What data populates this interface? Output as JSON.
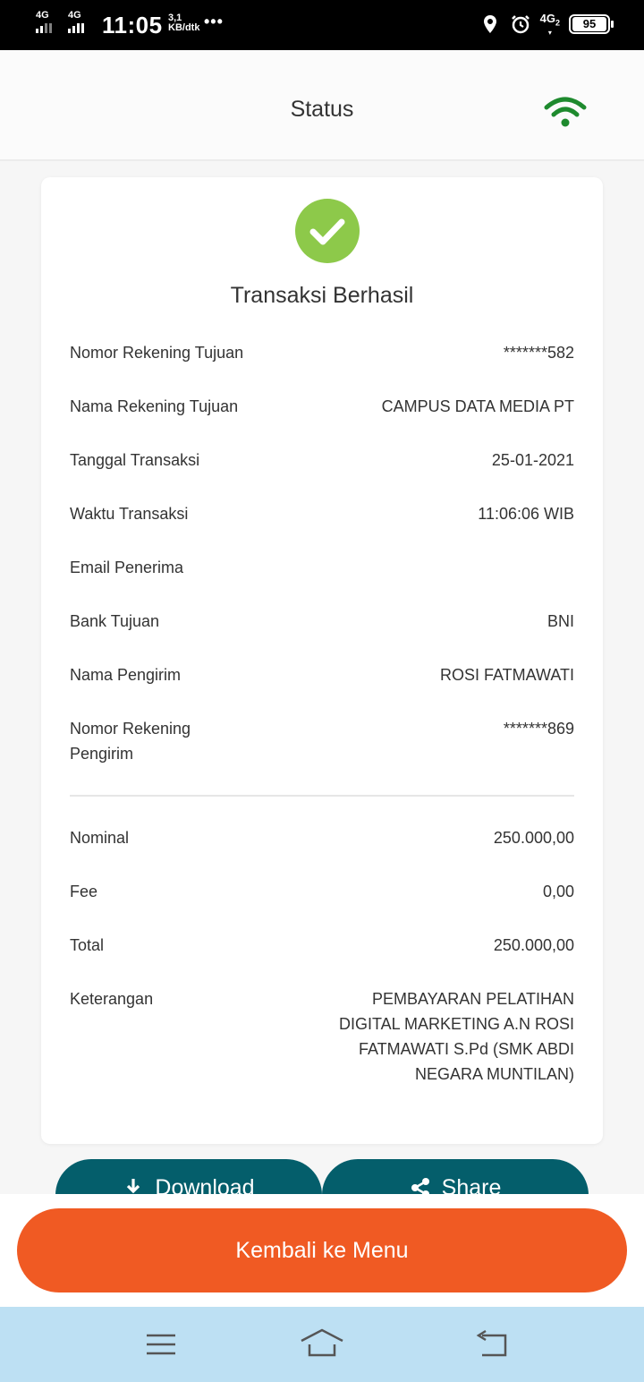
{
  "status_bar": {
    "sim1": "4G",
    "sim2": "4G",
    "time": "11:05",
    "speed_value": "3,1",
    "speed_unit": "KB/dtk",
    "more": "•••",
    "network": "4G",
    "network_sub": "2",
    "battery": "95"
  },
  "header": {
    "title": "Status"
  },
  "receipt": {
    "status_title": "Transaksi Berhasil",
    "rows": [
      {
        "label": "Nomor Rekening Tujuan",
        "value": "*******582"
      },
      {
        "label": "Nama Rekening Tujuan",
        "value": "CAMPUS DATA MEDIA PT"
      },
      {
        "label": "Tanggal Transaksi",
        "value": "25-01-2021"
      },
      {
        "label": "Waktu Transaksi",
        "value": "11:06:06 WIB"
      },
      {
        "label": "Email Penerima",
        "value": ""
      },
      {
        "label": "Bank Tujuan",
        "value": "BNI"
      },
      {
        "label": "Nama Pengirim",
        "value": "ROSI FATMAWATI"
      },
      {
        "label": "Nomor Rekening Pengirim",
        "value": "*******869"
      }
    ],
    "amounts": [
      {
        "label": "Nominal",
        "value": "250.000,00"
      },
      {
        "label": "Fee",
        "value": "0,00"
      },
      {
        "label": "Total",
        "value": "250.000,00"
      },
      {
        "label": "Keterangan",
        "value": "PEMBAYARAN PELATIHAN DIGITAL MARKETING A.N ROSI FATMAWATI S.Pd (SMK ABDI NEGARA MUNTILAN)"
      }
    ]
  },
  "actions": {
    "download_label": "Download",
    "share_label": "Share",
    "back_label": "Kembali ke Menu"
  },
  "colors": {
    "success": "#8dc94a",
    "wifi": "#1e8a2e",
    "action_button": "#045e6b",
    "primary_button": "#f05a23",
    "navbar": "#bde0f3"
  },
  "icons": {
    "wifi": "wifi-icon",
    "check": "check-circle-icon",
    "download": "download-icon",
    "share": "share-icon",
    "menu": "menu-icon",
    "home": "home-icon",
    "back": "back-icon"
  }
}
